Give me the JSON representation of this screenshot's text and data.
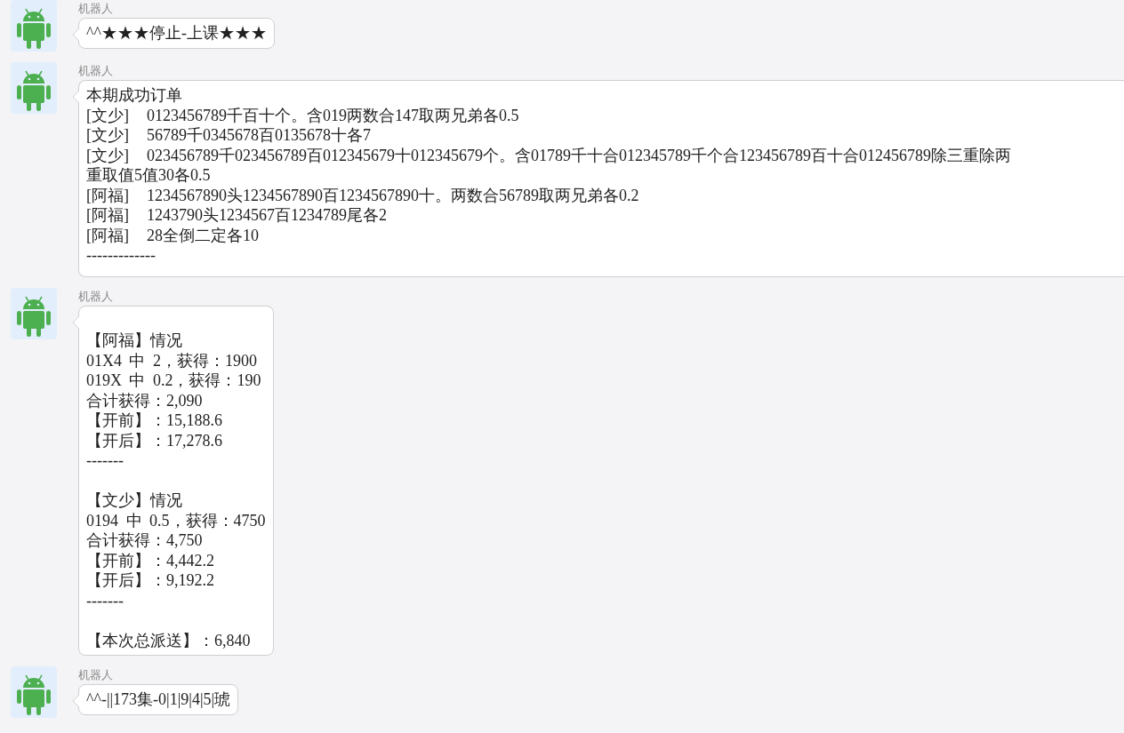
{
  "messages": [
    {
      "sender": "机器人",
      "paragraphs": [
        [
          "^^★★★停止-上课★★★"
        ]
      ],
      "wide": false,
      "top_blank": false
    },
    {
      "sender": "机器人",
      "paragraphs": [
        [
          "本期成功订单",
          "[文少]\t0123456789千百十个。含019两数合147取两兄弟各0.5",
          "[文少]\t56789千0345678百0135678十各7",
          "[文少]\t023456789千023456789百012345679十012345679个。含01789千十合012345789千个合123456789百十合012456789除三重除两",
          "重取值5值30各0.5",
          "[阿福]\t1234567890头1234567890百1234567890十。两数合56789取两兄弟各0.2",
          "[阿福]\t1243790头1234567百1234789尾各2",
          "[阿福]\t28全倒二定各10",
          "-------------"
        ]
      ],
      "wide": true,
      "top_blank": false
    },
    {
      "sender": "机器人",
      "paragraphs": [
        [
          "【阿福】情况",
          "01X4 中 2，获得：1900",
          "019X 中 0.2，获得：190",
          "合计获得：2,090",
          "【开前】：15,188.6",
          "【开后】：17,278.6",
          "-------"
        ],
        [
          "【文少】情况",
          "0194 中 0.5，获得：4750",
          "合计获得：4,750",
          "【开前】：4,442.2",
          "【开后】：9,192.2",
          "-------"
        ],
        [
          "【本次总派送】：6,840"
        ]
      ],
      "wide": false,
      "top_blank": true
    },
    {
      "sender": "机器人",
      "paragraphs": [
        [
          "^^-||173集-0|1|9|4|5|琥"
        ]
      ],
      "wide": false,
      "top_blank": false
    }
  ]
}
